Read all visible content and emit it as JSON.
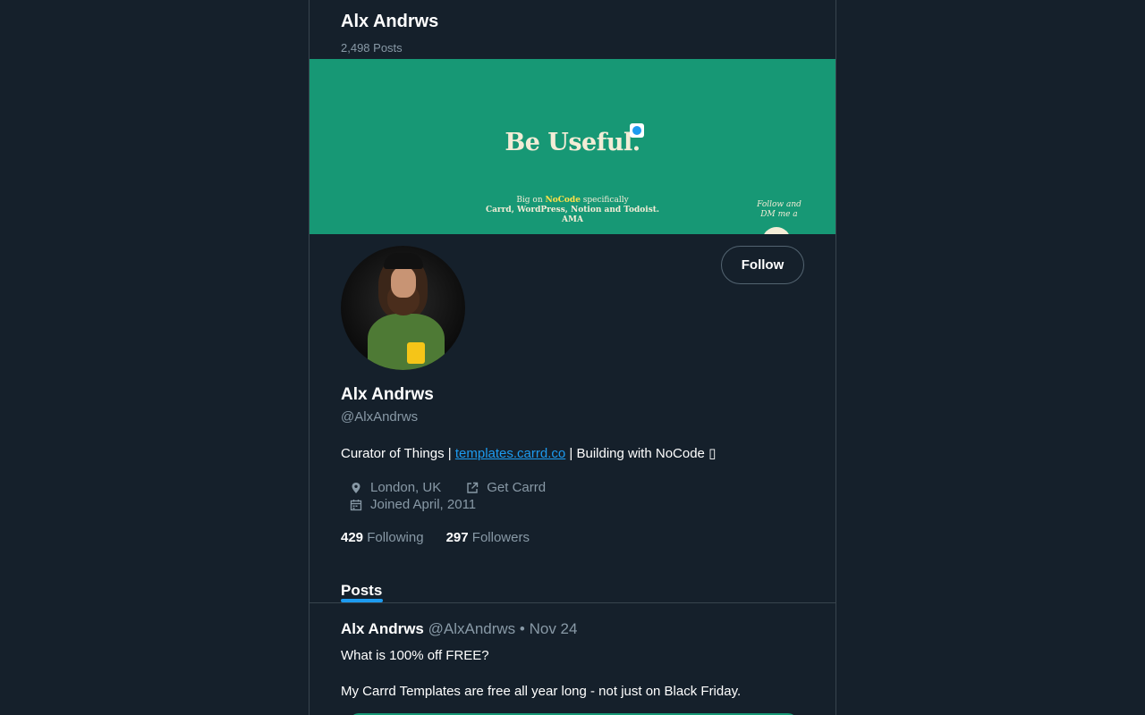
{
  "header": {
    "name": "Alx Andrws",
    "post_count": "2,498 Posts"
  },
  "banner": {
    "headline": "Be Useful.",
    "line1_pre": "Big on ",
    "line1_highlight": "NoCode",
    "line1_post": " specifically",
    "line2": "Carrd, WordPress, Notion and Todoist.",
    "line3": "AMA",
    "follow_note_1": "Follow and",
    "follow_note_2": "DM me a"
  },
  "profile": {
    "name": "Alx Andrws",
    "handle": "@AlxAndrws",
    "bio_pre": "Curator of Things | ",
    "bio_link": "templates.carrd.co",
    "bio_post": " | Building with NoCode ▯",
    "location": "London, UK",
    "website": "Get Carrd",
    "joined": "Joined April, 2011",
    "follow_label": "Follow"
  },
  "stats": {
    "following_count": "429",
    "following_label": "Following",
    "followers_count": "297",
    "followers_label": "Followers"
  },
  "tabs": {
    "posts": "Posts"
  },
  "post": {
    "name": "Alx Andrws",
    "meta": "@AlxAndrws • Nov 24",
    "line1": "What is 100% off FREE?",
    "line2": "My Carrd Templates are free all year long - not just on Black Friday."
  },
  "colors": {
    "background": "#15202b",
    "accent": "#1d9bf0",
    "banner": "#179875",
    "muted": "#8899a6"
  },
  "icons": {
    "location": "map-pin-icon",
    "website": "external-link-icon",
    "joined": "calendar-icon"
  }
}
